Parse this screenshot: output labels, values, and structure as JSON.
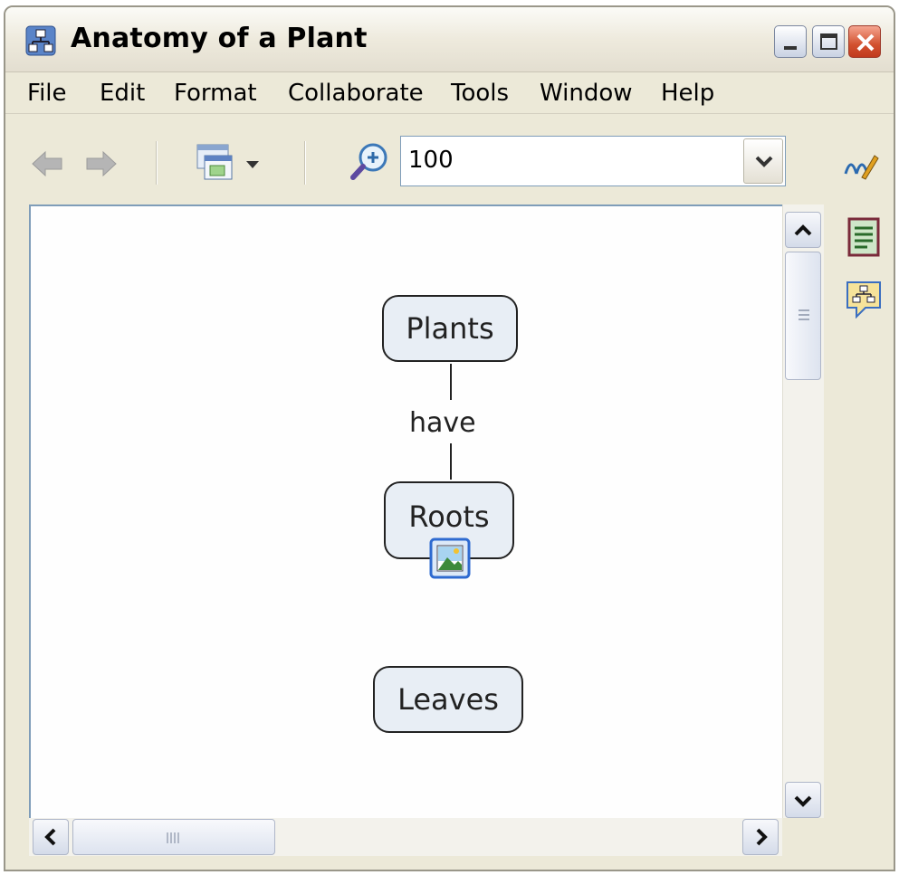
{
  "window": {
    "title": "Anatomy of a Plant"
  },
  "menu": [
    "File",
    "Edit",
    "Format",
    "Collaborate",
    "Tools",
    "Window",
    "Help"
  ],
  "toolbar": {
    "zoom_value": "100",
    "icons": [
      "back-arrow-icon",
      "forward-arrow-icon",
      "view-options-icon",
      "zoom-icon",
      "zoom-dropdown-icon",
      "styles-icon"
    ]
  },
  "side_panel": {
    "icons": [
      "notes-icon",
      "concept-map-comment-icon"
    ]
  },
  "concept_map": {
    "nodes": [
      {
        "label": "Plants"
      },
      {
        "label": "Roots"
      },
      {
        "label": "Leaves"
      }
    ],
    "links": [
      {
        "label": "have"
      }
    ]
  },
  "colors": {
    "node_fill": "#e8eef5",
    "node_border": "#222222",
    "chrome": "#ece9d8",
    "close_button": "#d2512f"
  }
}
